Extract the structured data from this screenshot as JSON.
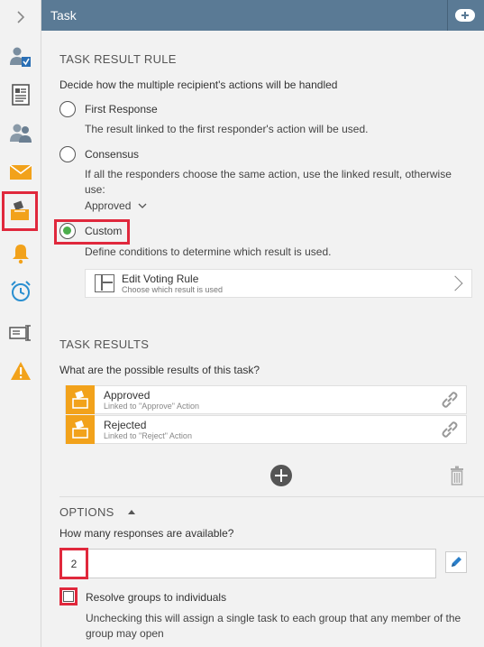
{
  "header": {
    "title": "Task"
  },
  "rail": {
    "items": [
      "chevron-right-icon",
      "user-check-icon",
      "document-form-icon",
      "users-icon",
      "envelope-icon",
      "ballot-box-icon",
      "bell-icon",
      "alarm-clock-icon",
      "text-cursor-icon",
      "warning-icon"
    ],
    "selected": "ballot-box-icon"
  },
  "task_result_rule": {
    "title": "TASK RESULT RULE",
    "description": "Decide how the multiple recipient's actions will be handled",
    "options": [
      {
        "label": "First Response",
        "description": "The result linked to the first responder's action will be used.",
        "checked": false
      },
      {
        "label": "Consensus",
        "description": "If all the responders choose the same action, use the linked result, otherwise use:",
        "dropdown_value": "Approved",
        "checked": false
      },
      {
        "label": "Custom",
        "description": "Define conditions to determine which result is used.",
        "checked": true
      }
    ],
    "voting_rule": {
      "title": "Edit Voting Rule",
      "subtitle": "Choose which result is used"
    }
  },
  "task_results": {
    "title": "TASK RESULTS",
    "description": "What are the possible results of this task?",
    "items": [
      {
        "name": "Approved",
        "linked": "Linked to \"Approve\" Action"
      },
      {
        "name": "Rejected",
        "linked": "Linked to \"Reject\" Action"
      }
    ]
  },
  "options": {
    "title": "OPTIONS",
    "question": "How many responses are available?",
    "responses_value": "2",
    "checkbox_label": "Resolve groups to individuals",
    "checkbox_checked": false,
    "checkbox_help": "Unchecking this will assign a single task to each group that any member of the group may open"
  },
  "colors": {
    "header": "#5a7a95",
    "accent_orange": "#f2a21b",
    "highlight_red": "#e0283c",
    "radio_green": "#4cae4c",
    "edit_blue": "#2a7fc9"
  }
}
